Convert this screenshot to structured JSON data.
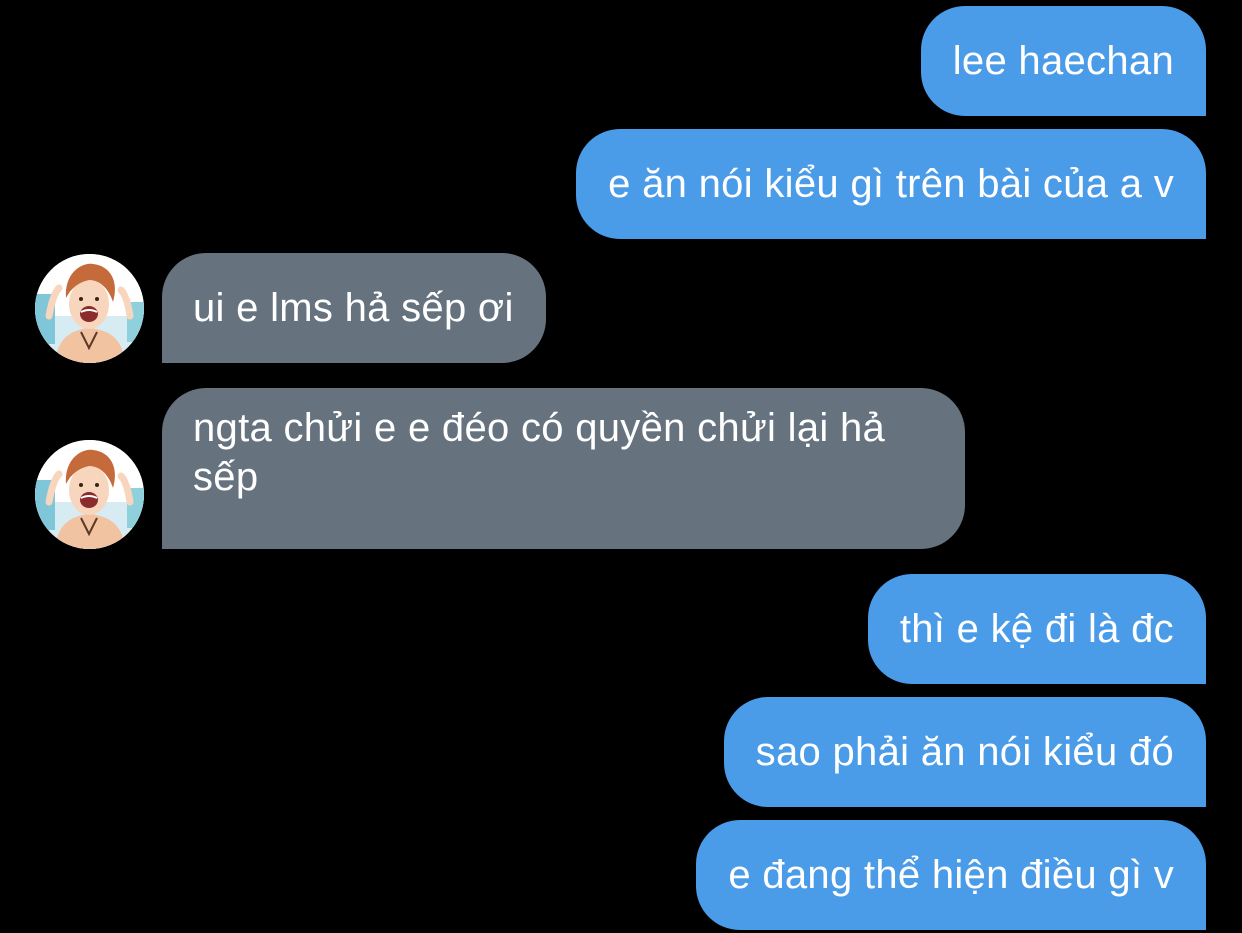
{
  "colors": {
    "background": "#000000",
    "outgoing_bubble": "#4a9be8",
    "incoming_bubble": "#66737f",
    "text": "#ffffff"
  },
  "messages": [
    {
      "direction": "outgoing",
      "text": "lee haechan"
    },
    {
      "direction": "outgoing",
      "text": "e ăn nói kiểu gì trên bài của a v"
    },
    {
      "direction": "incoming",
      "text": "ui e lms hả sếp ơi",
      "avatar": "contact-avatar"
    },
    {
      "direction": "incoming",
      "text": "ngta chửi e e đéo có quyền chửi lại hả sếp",
      "avatar": "contact-avatar"
    },
    {
      "direction": "outgoing",
      "text": "thì e kệ đi là đc"
    },
    {
      "direction": "outgoing",
      "text": "sao phải ăn nói kiểu đó"
    },
    {
      "direction": "outgoing",
      "text": "e đang thể hiện điều gì v"
    }
  ]
}
